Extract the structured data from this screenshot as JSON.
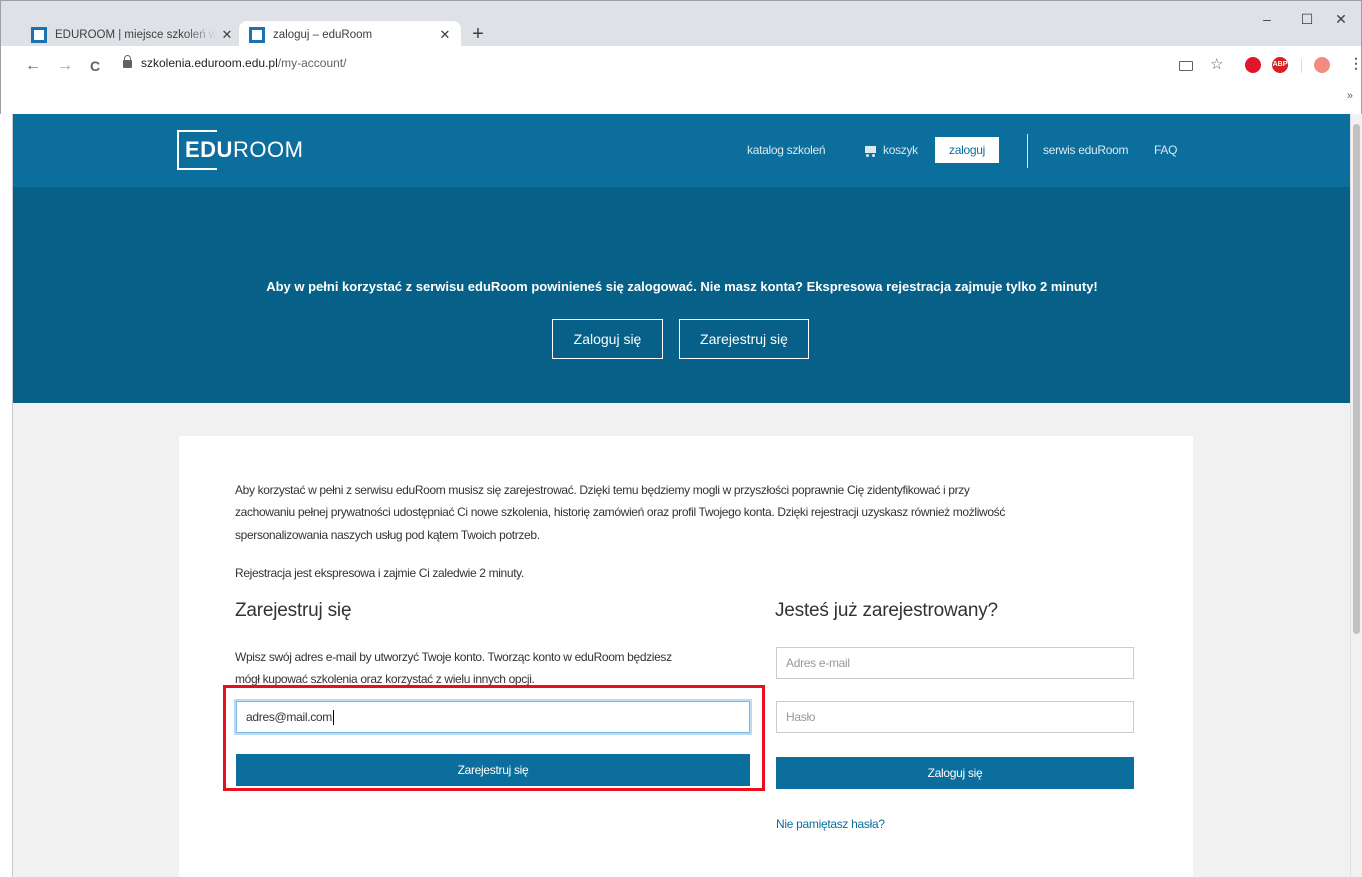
{
  "browser": {
    "tabs": [
      {
        "title": "EDUROOM | miejsce szkoleń w sieci",
        "active": false
      },
      {
        "title": "zaloguj – eduRoom",
        "active": true
      }
    ],
    "new_tab": "+",
    "window_controls": {
      "minimize": "–",
      "maximize": "☐",
      "close": "✕"
    },
    "address": {
      "host": "szkolenia.eduroom.edu.pl",
      "path": "/my-account/"
    },
    "nav": {
      "back": "←",
      "forward": "→",
      "reload": "C"
    },
    "toolbar_icons": [
      "cast-icon",
      "star-icon",
      "opera-icon",
      "adblock-icon",
      "profile-icon",
      "menu-icon"
    ],
    "adblock_label": "ABP",
    "bookmarks_more": "»"
  },
  "site": {
    "logo": {
      "bold": "EDU",
      "rest": "ROOM"
    },
    "nav": {
      "catalog": "katalog szkoleń",
      "cart": "koszyk",
      "login": "zaloguj",
      "service": "serwis eduRoom",
      "faq": "FAQ"
    },
    "hero": {
      "text": "Aby w pełni korzystać z serwisu eduRoom powinieneś się zalogować. Nie masz konta? Ekspresowa rejestracja zajmuje tylko 2 minuty!",
      "login_button": "Zaloguj się",
      "register_button": "Zarejestruj się"
    }
  },
  "main": {
    "intro_line1": "Aby korzystać w pełni z serwisu eduRoom musisz się zarejestrować. Dzięki temu będziemy mogli w przyszłości poprawnie Cię zidentyfikować i przy",
    "intro_line2": "zachowaniu pełnej prywatności udostępniać Ci nowe szkolenia, historię zamówień oraz profil Twojego konta. Dzięki rejestracji uzyskasz również możliwość",
    "intro_line3": "spersonalizowania naszych usług pod kątem Twoich potrzeb.",
    "express": "Rejestracja jest ekspresowa i zajmie Ci zaledwie 2 minuty.",
    "register": {
      "heading": "Zarejestruj się",
      "desc_line1": "Wpisz swój adres e-mail by utworzyć Twoje konto. Tworząc konto w eduRoom będziesz",
      "desc_line2": "mógł kupować szkolenia oraz korzystać z wielu innych opcji.",
      "email_value": "adres@mail.com",
      "button": "Zarejestruj się"
    },
    "login": {
      "heading": "Jesteś już zarejestrowany?",
      "email_placeholder": "Adres e-mail",
      "password_placeholder": "Hasło",
      "button": "Zaloguj się",
      "forgot": "Nie pamiętasz hasła?"
    }
  },
  "colors": {
    "header": "#0c6e9c",
    "hero": "#066087",
    "accent": "#0c6e9c",
    "highlight": "#e8101c"
  }
}
